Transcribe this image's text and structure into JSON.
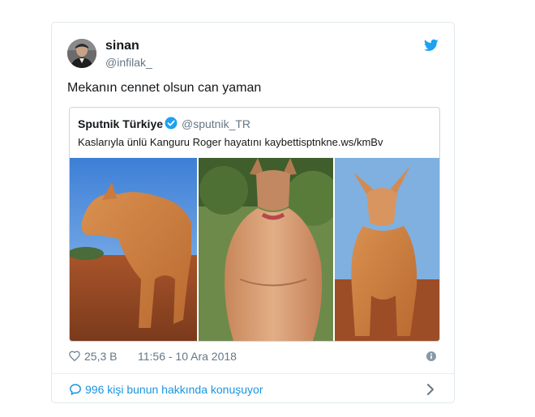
{
  "tweet": {
    "author_name": "sinan",
    "author_handle": "@infilak_",
    "text": "Mekanın cennet olsun can yaman",
    "likes": "25,3 B",
    "timestamp": "11:56 - 10 Ara 2018",
    "conversation_label": "996 kişi bunun hakkında konuşuyor"
  },
  "quoted": {
    "name": "Sputnik Türkiye",
    "handle": "@sputnik_TR",
    "text": "Kaslarıyla ünlü Kanguru Roger hayatını kaybettisptnkne.ws/kmBv"
  },
  "icons": {
    "brand": "twitter-bird-icon",
    "verified": "verified-badge-icon",
    "like": "heart-icon",
    "info": "info-icon",
    "reply": "comment-bubble-icon",
    "open": "chevron-right-icon"
  },
  "colors": {
    "twitter_blue": "#1da1f2",
    "link_blue": "#1b95e0",
    "secondary_text": "#657786",
    "border": "#e1e8ed"
  }
}
